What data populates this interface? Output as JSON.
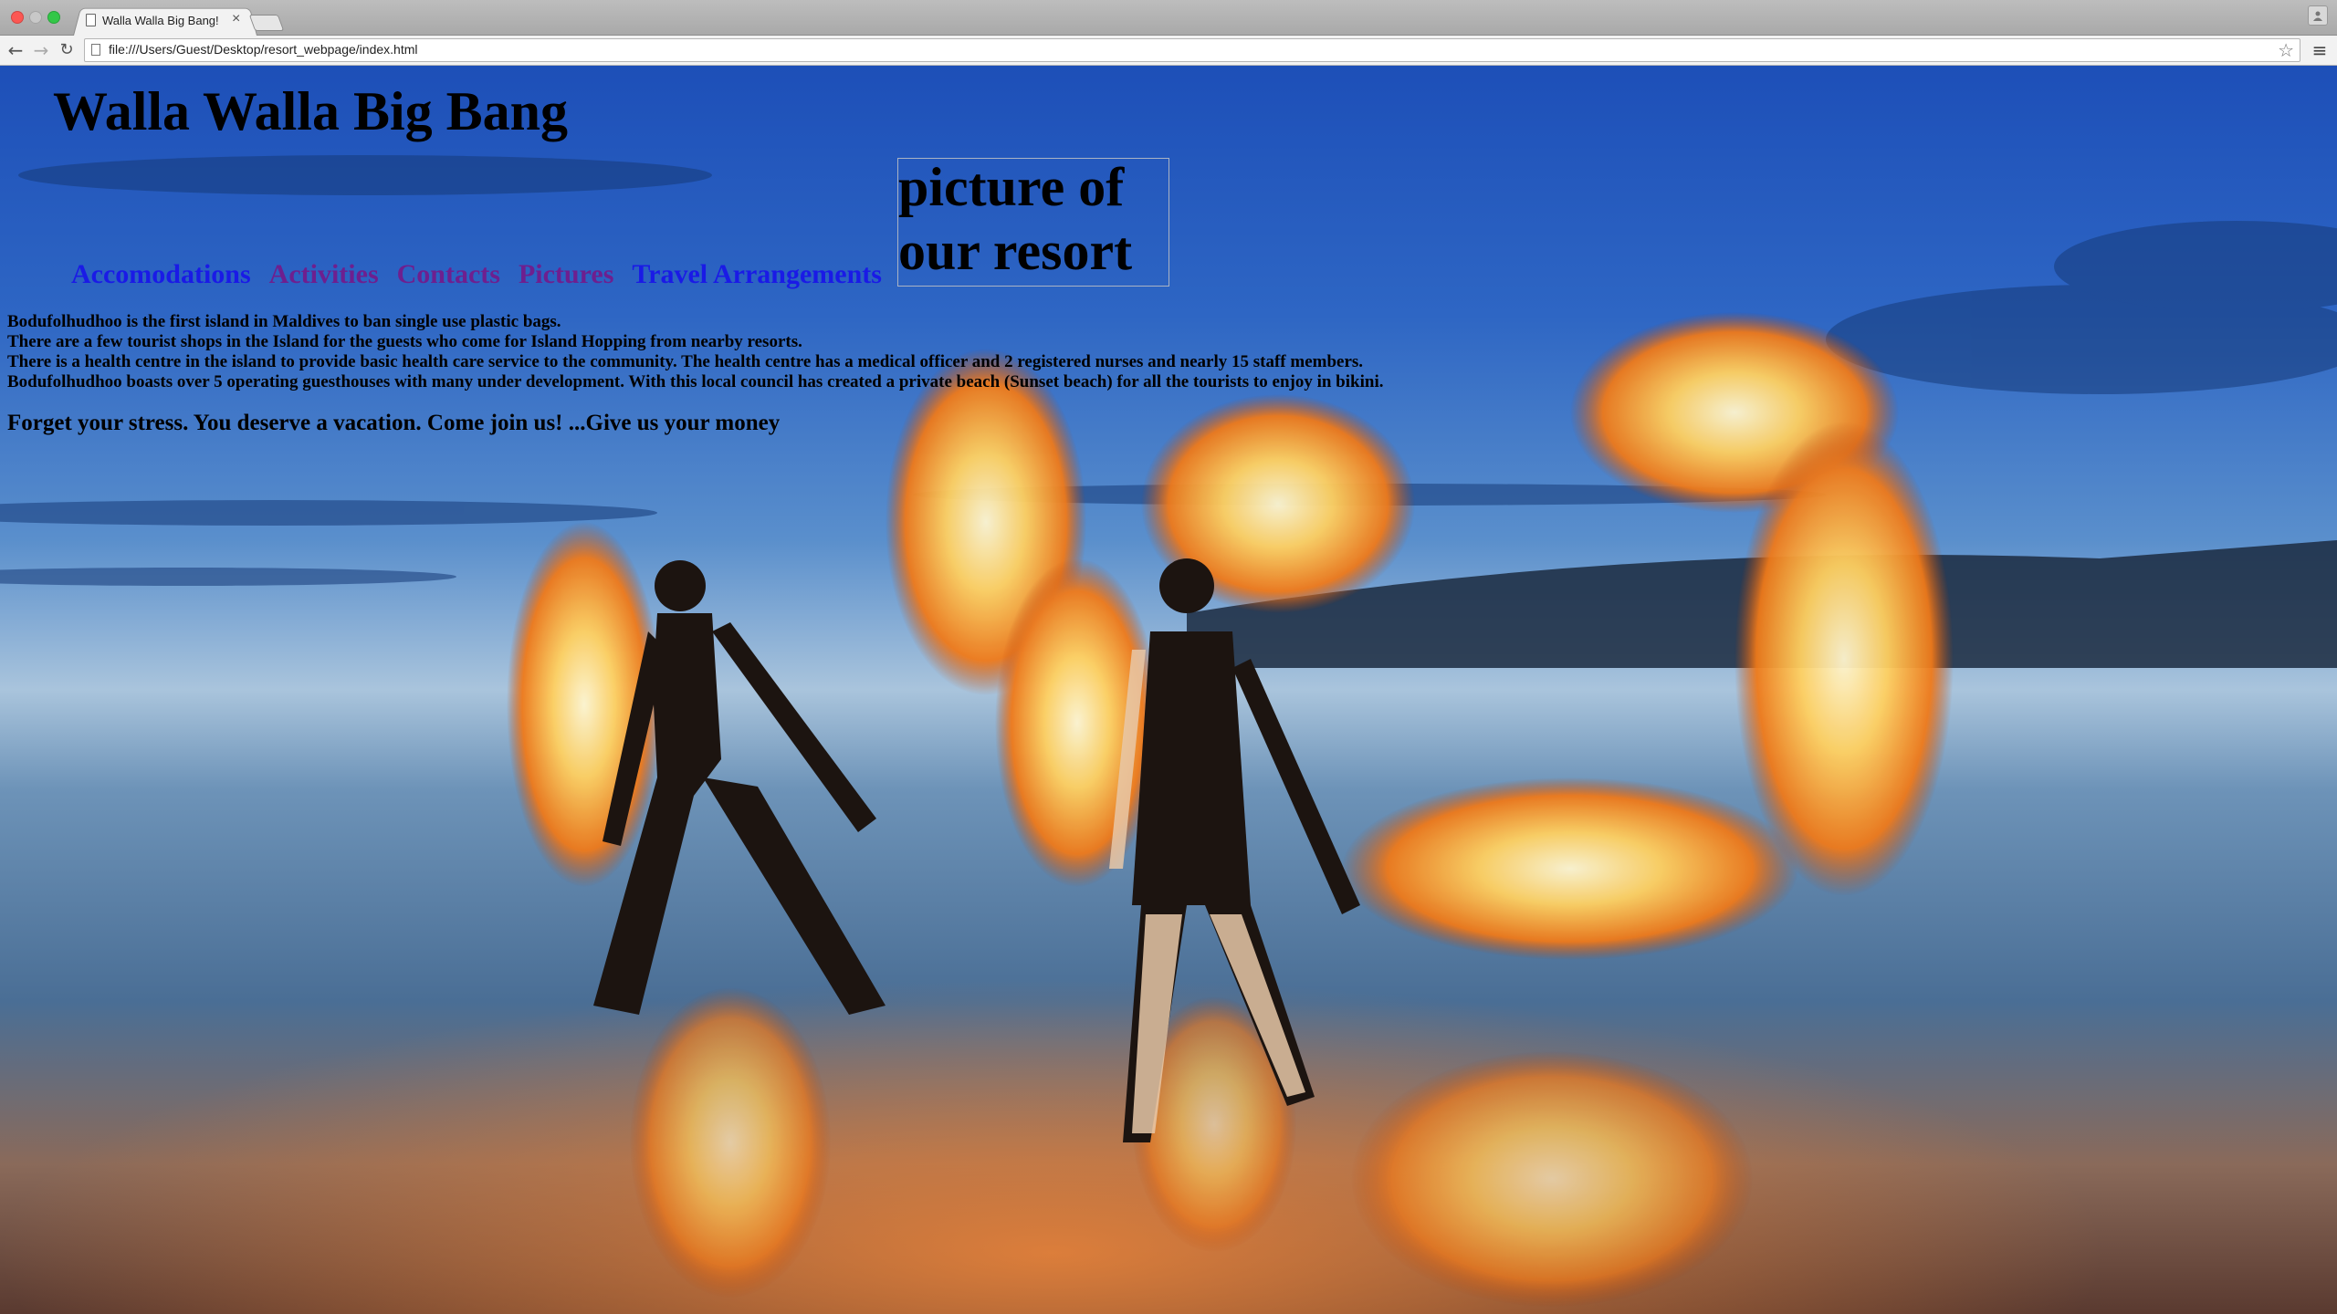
{
  "browser": {
    "tab": {
      "title": "Walla Walla Big Bang!",
      "close_glyph": "×"
    },
    "toolbar": {
      "back_glyph": "←",
      "forward_glyph": "→",
      "reload_glyph": "↻",
      "url": "file:///Users/Guest/Desktop/resort_webpage/index.html",
      "star_glyph": "☆",
      "menu_glyph": "≡"
    },
    "icons": [
      "close-window-icon",
      "minimize-window-icon",
      "maximize-window-icon",
      "page-icon",
      "back-arrow-icon",
      "forward-arrow-icon",
      "reload-icon",
      "star-icon",
      "menu-icon",
      "profile-icon"
    ],
    "colors": {
      "close": "#fc5753",
      "maximize": "#33c748",
      "link_unvisited": "#1a1ae6",
      "link_visited": "#6e1f8f"
    }
  },
  "page": {
    "title": "Walla Walla Big Bang",
    "picture_alt": "picture of our resort",
    "nav": [
      {
        "label": "Accomodations",
        "state": "unvisited"
      },
      {
        "label": "Activities",
        "state": "visited"
      },
      {
        "label": "Contacts",
        "state": "visited"
      },
      {
        "label": "Pictures",
        "state": "visited"
      },
      {
        "label": "Travel Arrangements",
        "state": "unvisited"
      }
    ],
    "info": [
      "Bodufolhudhoo is the first island in Maldives to ban single use plastic bags.",
      "There are a few tourist shops in the Island for the guests who come for Island Hopping from nearby resorts.",
      "There is a health centre in the island to provide basic health care service to the community. The health centre has a medical officer and 2 registered nurses and nearly 15 staff members.",
      "Bodufolhudhoo boasts over 5 operating guesthouses with many under development. With this local council has created a private beach (Sunset beach) for all the tourists to enjoy in bikini."
    ],
    "tagline": "Forget your stress. You deserve a vacation. Come join us! ...Give us your money"
  }
}
